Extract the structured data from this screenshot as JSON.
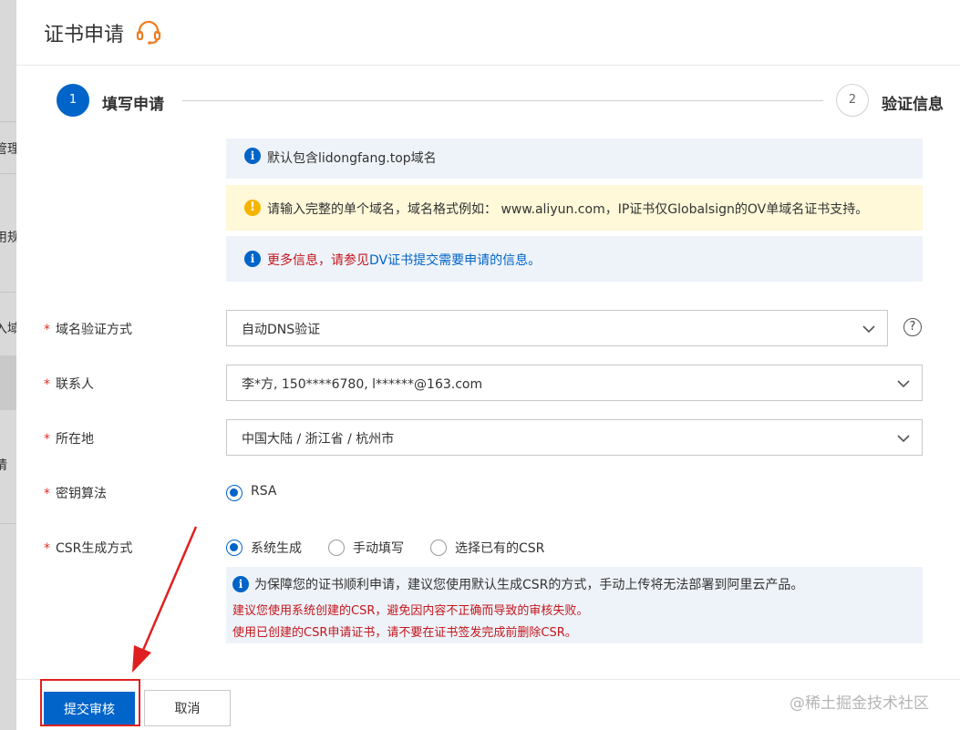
{
  "header": {
    "title": "证书申请"
  },
  "steps": [
    {
      "number": "1",
      "label": "填写申请"
    },
    {
      "number": "2",
      "label": "验证信息"
    }
  ],
  "alerts": {
    "default_domain": "默认包含lidongfang.top域名",
    "domain_format": "请输入完整的单个域名，域名格式例如： www.aliyun.com，IP证书仅Globalsign的OV单域名证书支持。",
    "more_info_prefix": "更多信息，请参见",
    "more_info_link": "DV证书提交需要申请的信息。"
  },
  "form": {
    "domain_verification": {
      "label": "域名验证方式",
      "value": "自动DNS验证"
    },
    "contact": {
      "label": "联系人",
      "value": "李*方, 150****6780, l******@163.com"
    },
    "location": {
      "label": "所在地",
      "value": "中国大陆 / 浙江省 / 杭州市"
    },
    "key_algorithm": {
      "label": "密钥算法",
      "option": "RSA"
    },
    "csr": {
      "label": "CSR生成方式",
      "options": [
        "系统生成",
        "手动填写",
        "选择已有的CSR"
      ],
      "note_info": "为保障您的证书顺利申请，建议您使用默认生成CSR的方式，手动上传将无法部署到阿里云产品。",
      "note_warn1": "建议您使用系统创建的CSR，避免因内容不正确而导致的审核失败。",
      "note_warn2": "使用已创建的CSR申请证书，请不要在证书签发完成前删除CSR。"
    }
  },
  "footer": {
    "submit_label": "提交审核",
    "cancel_label": "取消"
  },
  "watermark": "@稀土掘金技术社区",
  "background": {
    "fragments": [
      "管理",
      "用规",
      "入域",
      "请"
    ]
  },
  "colors": {
    "primary": "#0064c8",
    "error": "#c4161c",
    "warning": "#f5b400",
    "annotation": "#e02020"
  }
}
